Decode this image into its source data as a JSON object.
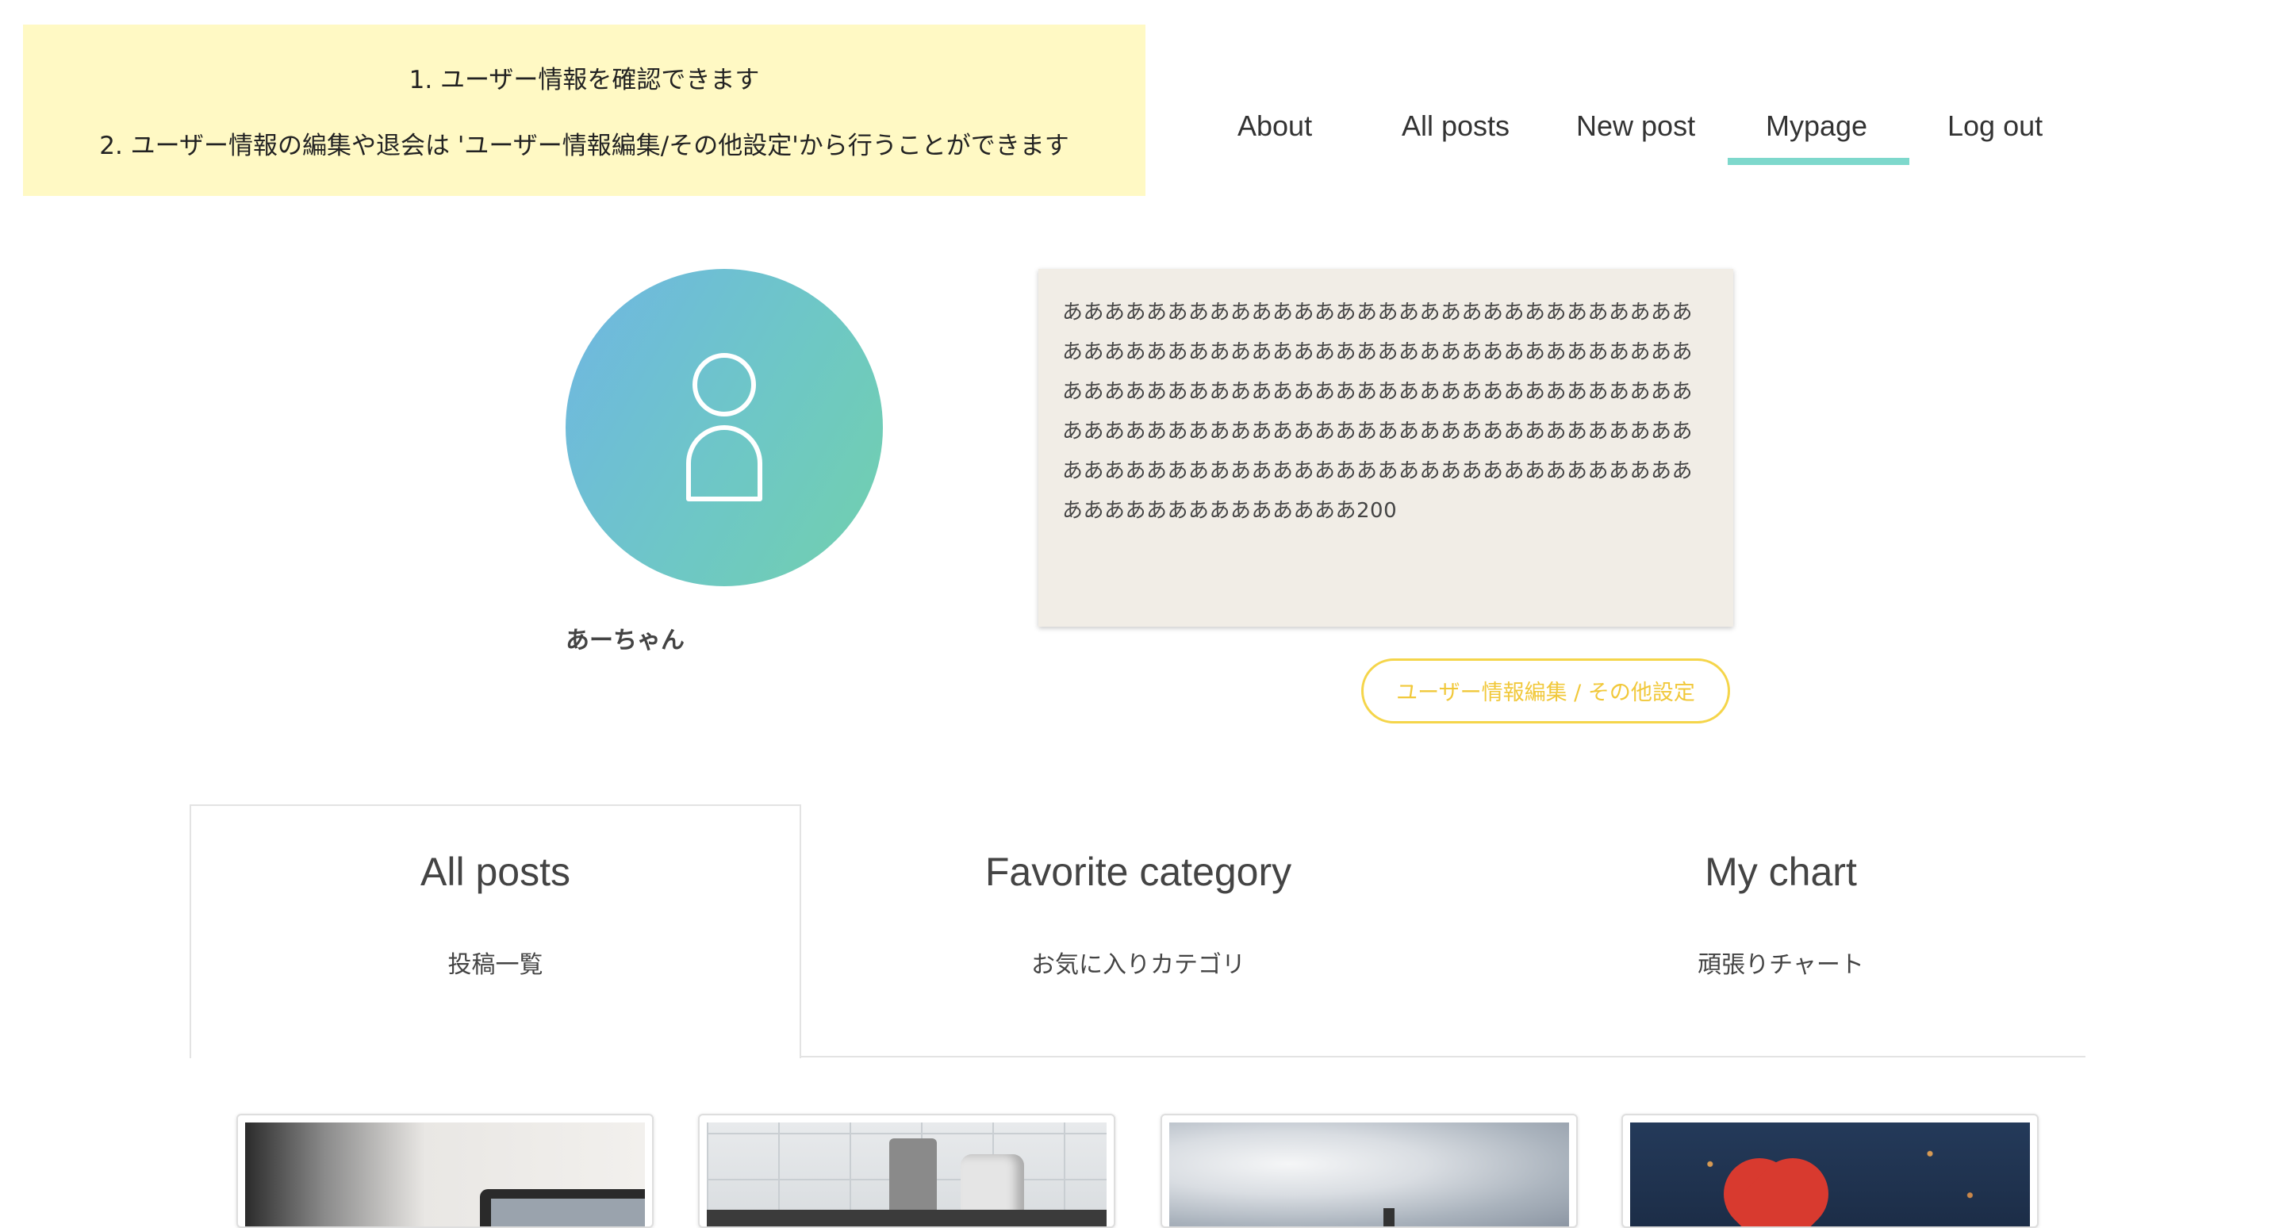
{
  "notice": {
    "line1": "1. ユーザー情報を確認できます",
    "line2": "2. ユーザー情報の編集や退会は 'ユーザー情報編集/その他設定'から行うことができます"
  },
  "nav": {
    "items": [
      "About",
      "All posts",
      "New post",
      "Mypage",
      "Log out"
    ],
    "active": "Mypage",
    "accent_color": "#7ed8cc"
  },
  "profile": {
    "username": "あーちゃん",
    "avatar_icon": "user-icon",
    "bio": "ああああああああああああああああああああああああああああああああああああああああああああああああああああああああああああああああああああああああああああああああああああああああああああああああああああああああああああああああああああああああああああああああああああああああああああああああああああああああああああああああああああ200",
    "edit_button": "ユーザー情報編集 / その他設定"
  },
  "tabs": [
    {
      "title": "All posts",
      "subtitle": "投稿一覧"
    },
    {
      "title": "Favorite category",
      "subtitle": "お気に入りカテゴリ"
    },
    {
      "title": "My chart",
      "subtitle": "頑張りチャート"
    }
  ],
  "active_tab": "All posts",
  "colors": {
    "notice_bg": "#fff9c4",
    "bio_bg": "#f1ede6",
    "button_accent": "#f5d54a"
  }
}
